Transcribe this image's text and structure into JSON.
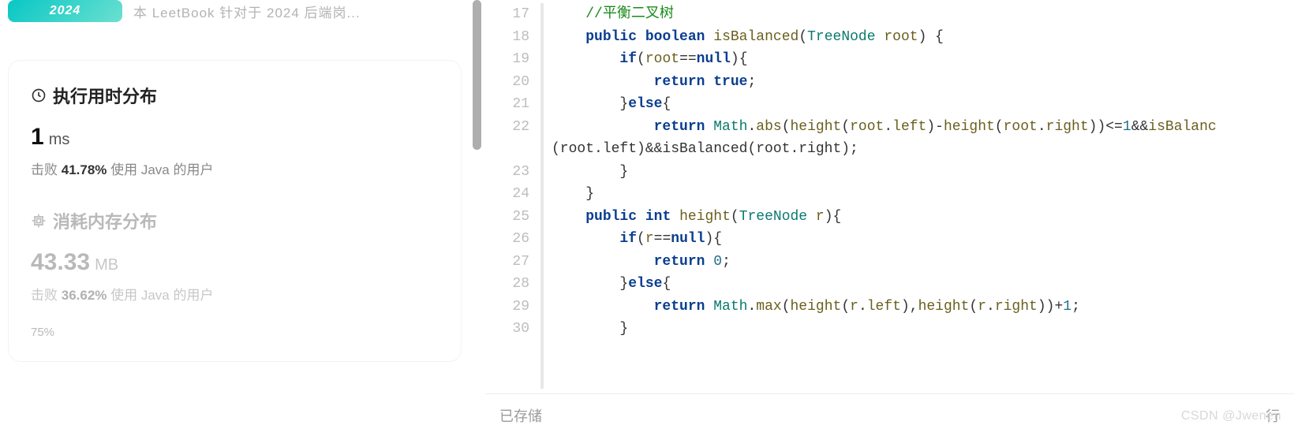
{
  "promo": {
    "badge": "2024",
    "text": "本 LeetBook 针对于 2024 后端岗..."
  },
  "stats": {
    "runtime": {
      "title": "执行用时分布",
      "value": "1",
      "unit": "ms",
      "beat_prefix": "击败 ",
      "beat_pct": "41.78%",
      "beat_suffix": " 使用 Java 的用户"
    },
    "memory": {
      "title": "消耗内存分布",
      "value": "43.33",
      "unit": "MB",
      "beat_prefix": "击败 ",
      "beat_pct": "36.62%",
      "beat_suffix": " 使用 Java 的用户"
    },
    "chart_tick": "75%"
  },
  "code": {
    "line_start": 17,
    "lines": {
      "l17": "//平衡二叉树",
      "l22_tail": "(root.left)&&isBalanced(root.right);"
    }
  },
  "status": {
    "saved": "已存储",
    "right": "行"
  },
  "watermark": "CSDN @Jwenen"
}
